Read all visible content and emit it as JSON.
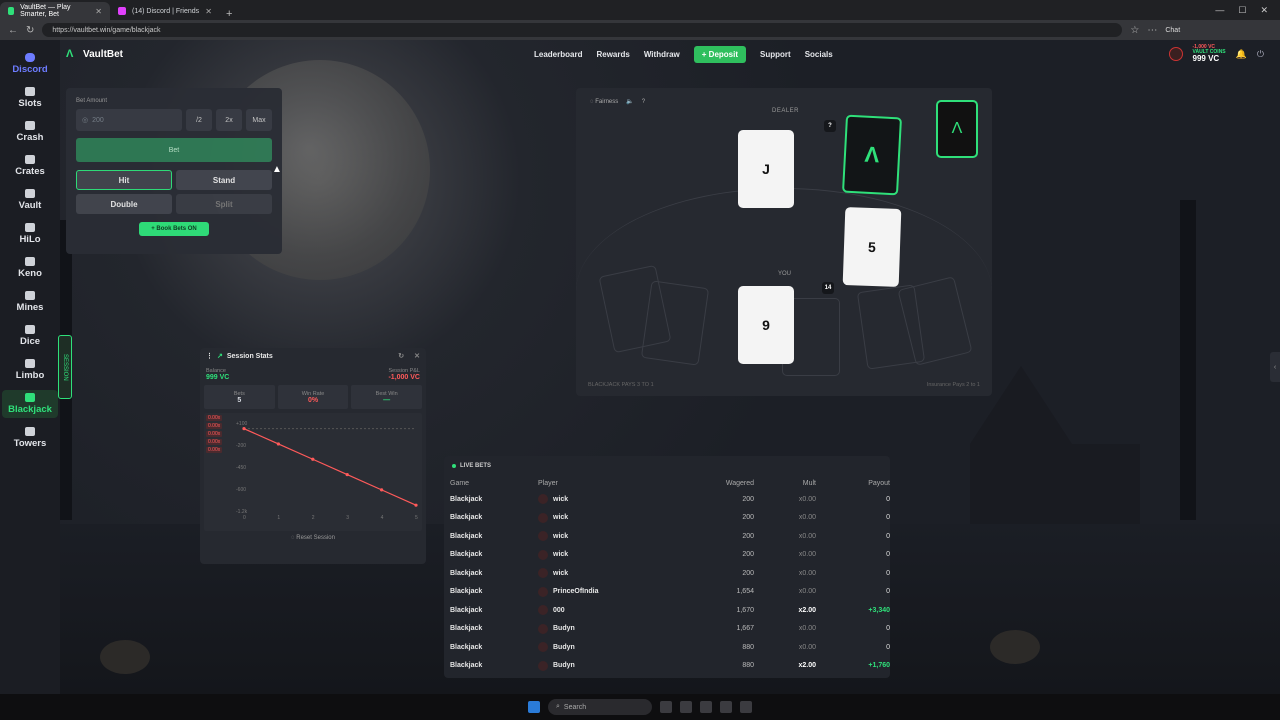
{
  "browser": {
    "tabs": [
      {
        "title": "VaultBet — Play Smarter, Bet",
        "active": true,
        "favicon_color": "#2fe07a"
      },
      {
        "title": "(14) Discord | Friends",
        "active": false,
        "favicon_color": "#e040fb"
      }
    ],
    "url": "https://vaultbet.win/game/blackjack",
    "chat_label": "Chat"
  },
  "sidebar": {
    "items": [
      {
        "label": "Discord",
        "icon": "discord-icon"
      },
      {
        "label": "Slots",
        "icon": "slots-icon"
      },
      {
        "label": "Crash",
        "icon": "crash-icon"
      },
      {
        "label": "Crates",
        "icon": "crates-icon"
      },
      {
        "label": "Vault",
        "icon": "vault-icon"
      },
      {
        "label": "HiLo",
        "icon": "hilo-icon"
      },
      {
        "label": "Keno",
        "icon": "keno-icon"
      },
      {
        "label": "Mines",
        "icon": "mines-icon"
      },
      {
        "label": "Dice",
        "icon": "dice-icon"
      },
      {
        "label": "Limbo",
        "icon": "limbo-icon"
      },
      {
        "label": "Blackjack",
        "icon": "blackjack-icon"
      },
      {
        "label": "Towers",
        "icon": "towers-icon"
      }
    ],
    "session_tab": "SESSION"
  },
  "header": {
    "brand": "VaultBet",
    "nav": [
      "Leaderboard",
      "Rewards",
      "Withdraw",
      "Deposit",
      "Support",
      "Socials"
    ],
    "vault_coins_label": "VAULT COINS",
    "balance": "999 VC",
    "delta": "-1,000 VC"
  },
  "bet_panel": {
    "bet_amount_label": "Bet Amount",
    "bet_amount_value": "200",
    "half": "/2",
    "double_x": "2x",
    "max": "Max",
    "bet": "Bet",
    "hit": "Hit",
    "stand": "Stand",
    "double": "Double",
    "split": "Split",
    "book_bets": "+ Book Bets ON"
  },
  "table": {
    "fairness": "Fairness",
    "dealer_label": "DEALER",
    "you_label": "YOU",
    "dealer_hidden": "?",
    "dealer_cards": [
      "J"
    ],
    "player_cards": [
      "9",
      "5"
    ],
    "player_total": "14",
    "footer_left": "BLACKJACK PAYS 3 TO 1",
    "footer_right": "Insurance Pays 2 to 1"
  },
  "session_stats": {
    "title": "Session Stats",
    "balance_label": "Balance",
    "balance_value": "999 VC",
    "pnl_label": "Session P&L",
    "pnl_value": "-1,000 VC",
    "bets_label": "Bets",
    "bets_value": "5",
    "win_rate_label": "Win Rate",
    "win_rate_value": "0%",
    "best_win_label": "Best Win",
    "best_win_value": "—",
    "pnl_tags": [
      "0.00x",
      "0.00x",
      "0.00x",
      "0.00x",
      "0.00x"
    ],
    "reset": "Reset Session",
    "chart_data": {
      "type": "line",
      "x": [
        0,
        1,
        2,
        3,
        4,
        5
      ],
      "series": [
        {
          "values": [
            0,
            -200,
            -400,
            -600,
            -800,
            -1000
          ]
        }
      ],
      "yticks": [
        "+100",
        "-200",
        "-450",
        "-600",
        "-1.2k"
      ],
      "xticks": [
        "0",
        "1",
        "2",
        "3",
        "4",
        "5"
      ]
    }
  },
  "live_bets": {
    "title": "LIVE BETS",
    "columns": [
      "Game",
      "Player",
      "Wagered",
      "Mult",
      "Payout"
    ],
    "rows": [
      {
        "game": "Blackjack",
        "player": "wick",
        "wagered": "200",
        "mult": "x0.00",
        "payout": "0"
      },
      {
        "game": "Blackjack",
        "player": "wick",
        "wagered": "200",
        "mult": "x0.00",
        "payout": "0"
      },
      {
        "game": "Blackjack",
        "player": "wick",
        "wagered": "200",
        "mult": "x0.00",
        "payout": "0"
      },
      {
        "game": "Blackjack",
        "player": "wick",
        "wagered": "200",
        "mult": "x0.00",
        "payout": "0"
      },
      {
        "game": "Blackjack",
        "player": "wick",
        "wagered": "200",
        "mult": "x0.00",
        "payout": "0"
      },
      {
        "game": "Blackjack",
        "player": "PrinceOfIndia",
        "wagered": "1,654",
        "mult": "x0.00",
        "payout": "0"
      },
      {
        "game": "Blackjack",
        "player": "000",
        "wagered": "1,670",
        "mult": "x2.00",
        "payout": "+3,340"
      },
      {
        "game": "Blackjack",
        "player": "Budyn",
        "wagered": "1,667",
        "mult": "x0.00",
        "payout": "0"
      },
      {
        "game": "Blackjack",
        "player": "Budyn",
        "wagered": "880",
        "mult": "x0.00",
        "payout": "0"
      },
      {
        "game": "Blackjack",
        "player": "Budyn",
        "wagered": "880",
        "mult": "x2.00",
        "payout": "+1,760"
      }
    ]
  },
  "taskbar": {
    "search": "Search"
  },
  "colors": {
    "accent": "#2fe07a",
    "loss": "#ff5a5a",
    "discord": "#6d7cff"
  }
}
